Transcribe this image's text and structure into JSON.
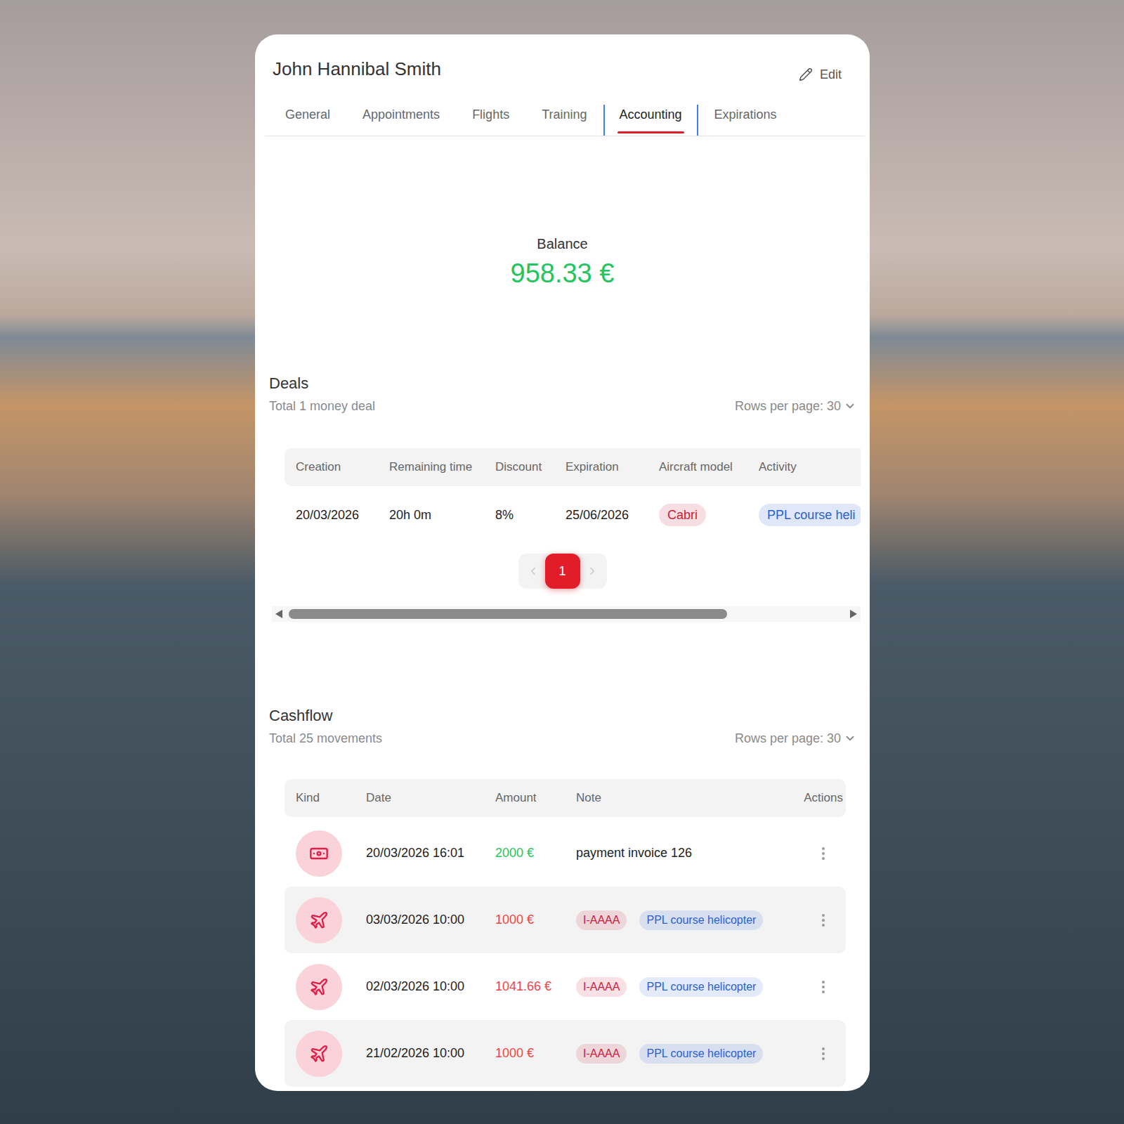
{
  "profile": {
    "name": "John Hannibal Smith",
    "edit_label": "Edit"
  },
  "tabs": [
    {
      "label": "General",
      "selected": false
    },
    {
      "label": "Appointments",
      "selected": false
    },
    {
      "label": "Flights",
      "selected": false
    },
    {
      "label": "Training",
      "selected": false
    },
    {
      "label": "Accounting",
      "selected": true
    },
    {
      "label": "Expirations",
      "selected": false
    }
  ],
  "balance": {
    "label": "Balance",
    "value": "958.33 €"
  },
  "deals": {
    "title": "Deals",
    "subtitle": "Total 1 money deal",
    "rows_per_page": "Rows per page: 30",
    "columns": [
      "Creation",
      "Remaining time",
      "Discount",
      "Expiration",
      "Aircraft model",
      "Activity"
    ],
    "rows": [
      {
        "creation": "20/03/2026",
        "remaining_time": "20h 0m",
        "discount": "8%",
        "expiration": "25/06/2026",
        "aircraft_model": {
          "label": "Cabri",
          "color": "#c8213f"
        },
        "activity": {
          "label": "PPL course heli",
          "color": "#2b5fd4"
        }
      }
    ],
    "pagination": {
      "pages": [
        {
          "label": "1",
          "selected": true
        }
      ]
    },
    "scrollbar": {
      "level": 0.79
    }
  },
  "cashflow": {
    "title": "Cashflow",
    "subtitle": "Total 25 movements",
    "rows_per_page": "Rows per page: 30",
    "columns": [
      "Kind",
      "Date",
      "Amount",
      "Note",
      "Actions"
    ],
    "rows": [
      {
        "kind": "payment",
        "date": "20/03/2026 16:01",
        "amount": "2000 €",
        "amount_color": "#22c55e",
        "note": "payment invoice 126",
        "tags": []
      },
      {
        "kind": "flight",
        "date": "03/03/2026 10:00",
        "amount": "1000 €",
        "amount_color": "#ef4444",
        "note": "",
        "tags": [
          {
            "label": "I-AAAA",
            "color": "#c8213f"
          },
          {
            "label": "PPL course helicopter",
            "color": "#2b5fd4"
          }
        ]
      },
      {
        "kind": "flight",
        "date": "02/03/2026 10:00",
        "amount": "1041.66 €",
        "amount_color": "#ef4444",
        "note": "",
        "tags": [
          {
            "label": "I-AAAA",
            "color": "#c8213f"
          },
          {
            "label": "PPL course helicopter",
            "color": "#2b5fd4"
          }
        ]
      },
      {
        "kind": "flight",
        "date": "21/02/2026 10:00",
        "amount": "1000 €",
        "amount_color": "#ef4444",
        "note": "",
        "tags": [
          {
            "label": "I-AAAA",
            "color": "#c8213f"
          },
          {
            "label": "PPL course helicopter",
            "color": "#2b5fd4"
          }
        ]
      }
    ]
  }
}
